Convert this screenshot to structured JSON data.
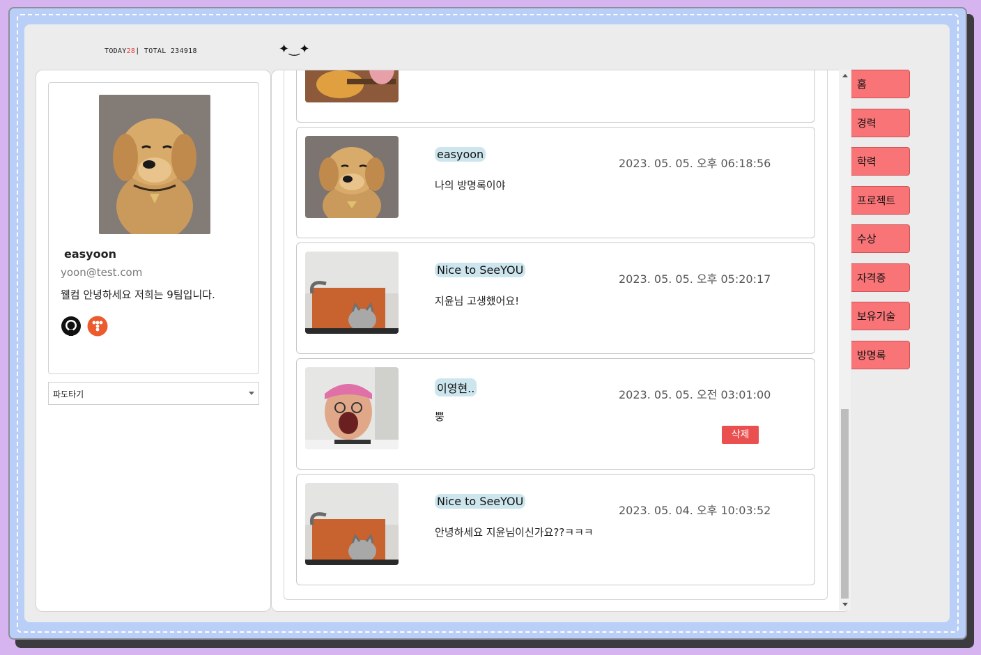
{
  "header": {
    "today_label": "TODAY",
    "today_count": "28",
    "separator": "|",
    "total_label": "TOTAL",
    "total_count": "234918",
    "face": "✦‿✦"
  },
  "profile": {
    "name": "easyoon",
    "email": "yoon@test.com",
    "bio": "웰컴 안녕하세요 저희는 9팀입니다.",
    "icons": [
      "github-icon",
      "tistory-icon"
    ]
  },
  "bgm": {
    "selected": "파도타기"
  },
  "guestbook": {
    "entries": [
      {
        "author": "easyoon",
        "date": "2023. 05. 05. 오후 06:18:56",
        "message": "나의 방명록이야",
        "thumb": "golden-retriever-photo"
      },
      {
        "author": "Nice to SeeYOU",
        "date": "2023. 05. 05. 오후 05:20:17",
        "message": "지윤님 고생했어요!",
        "thumb": "cat-in-box-photo"
      },
      {
        "author": "이영현..",
        "date": "2023. 05. 05. 오전 03:01:00",
        "message": "뿡",
        "thumb": "man-with-pink-headband-photo",
        "delete_label": "삭제"
      },
      {
        "author": "Nice to SeeYOU",
        "date": "2023. 05. 04. 오후 10:03:52",
        "message": "안녕하세요 지윤님이신가요??ㅋㅋㅋ",
        "thumb": "cat-in-box-photo"
      }
    ]
  },
  "nav": {
    "tabs": [
      "홈",
      "경력",
      "학력",
      "프로젝트",
      "수상",
      "자격증",
      "보유기술",
      "방명록"
    ]
  },
  "colors": {
    "background": "#d6b4f0",
    "frame": "#b9cff8",
    "inner": "#ececec",
    "tab": "#f87477",
    "author_badge": "#cde6ee",
    "delete": "#e9504f"
  }
}
